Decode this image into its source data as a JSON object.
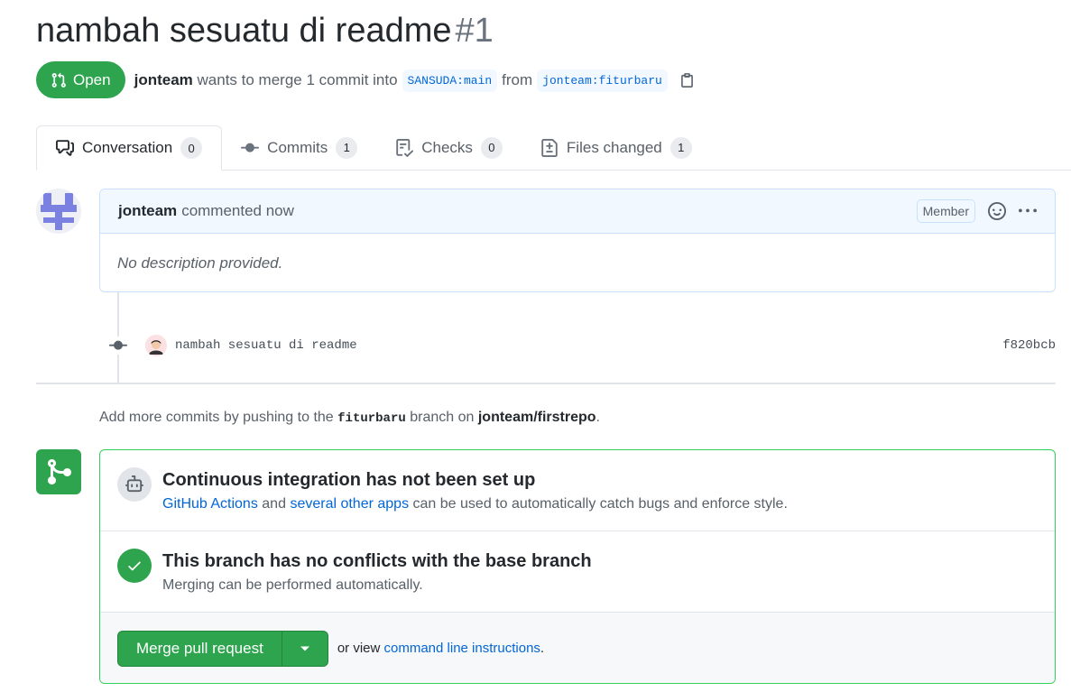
{
  "pr": {
    "title": "nambah sesuatu di readme",
    "number": "#1",
    "state": "Open",
    "author": "jonteam",
    "merge_text": "wants to merge 1 commit into",
    "base_branch": "SANSUDA:main",
    "from_word": "from",
    "head_branch": "jonteam:fiturbaru"
  },
  "tabs": [
    {
      "label": "Conversation",
      "count": "0"
    },
    {
      "label": "Commits",
      "count": "1"
    },
    {
      "label": "Checks",
      "count": "0"
    },
    {
      "label": "Files changed",
      "count": "1"
    }
  ],
  "comment": {
    "author": "jonteam",
    "time": "commented now",
    "badge": "Member",
    "body": "No description provided."
  },
  "commit": {
    "message": "nambah sesuatu di readme",
    "sha": "f820bcb"
  },
  "push_hint": {
    "prefix": "Add more commits by pushing to the",
    "branch": "fiturbaru",
    "middle": "branch on",
    "repo": "jonteam/firstrepo",
    "suffix": "."
  },
  "ci": {
    "title": "Continuous integration has not been set up",
    "link1": "GitHub Actions",
    "and": "and",
    "link2": "several other apps",
    "rest": "can be used to automatically catch bugs and enforce style."
  },
  "conflicts": {
    "title": "This branch has no conflicts with the base branch",
    "sub": "Merging can be performed automatically."
  },
  "merge": {
    "button": "Merge pull request",
    "or_view": "or view",
    "link": "command line instructions",
    "suffix": "."
  },
  "colors": {
    "green": "#2ea44f",
    "link": "#0366d6",
    "comment_border": "#c8e1ff"
  }
}
